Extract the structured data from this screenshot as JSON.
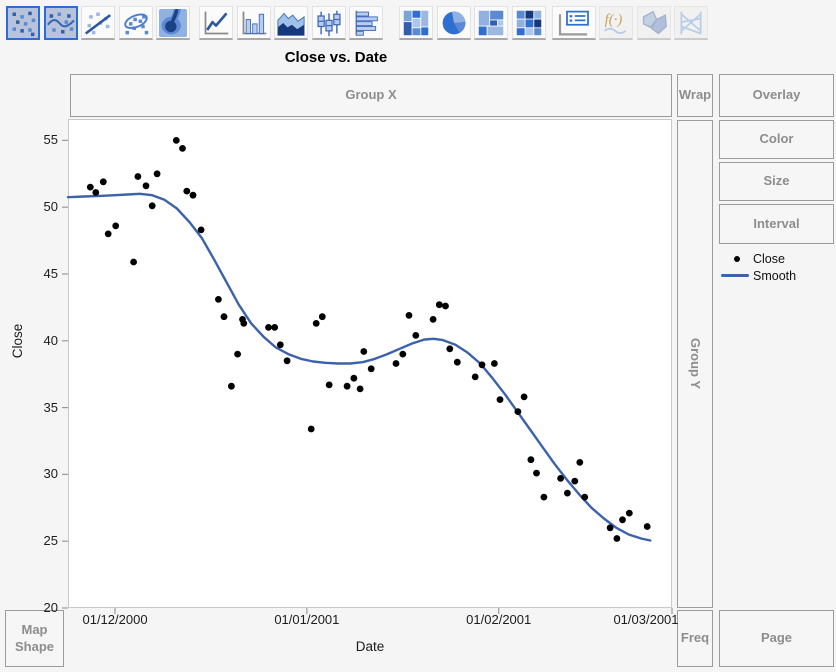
{
  "title": "Close vs. Date",
  "toolbar": {
    "items": [
      {
        "name": "points",
        "state": "selected"
      },
      {
        "name": "smoother",
        "state": "selected"
      },
      {
        "name": "line-of-fit",
        "state": "normal"
      },
      {
        "name": "ellipse",
        "state": "normal"
      },
      {
        "name": "contour",
        "state": "normal"
      },
      {
        "name": "line",
        "state": "normal"
      },
      {
        "name": "bar",
        "state": "normal"
      },
      {
        "name": "area",
        "state": "normal"
      },
      {
        "name": "box-plot",
        "state": "normal"
      },
      {
        "name": "histogram",
        "state": "normal"
      },
      {
        "name": "mosaic",
        "state": "normal"
      },
      {
        "name": "pie",
        "state": "normal"
      },
      {
        "name": "treemap",
        "state": "normal"
      },
      {
        "name": "heatmap",
        "state": "normal"
      },
      {
        "name": "caption-box",
        "state": "normal"
      },
      {
        "name": "formula",
        "state": "disabled"
      },
      {
        "name": "map-shapes",
        "state": "disabled"
      },
      {
        "name": "parallel",
        "state": "disabled"
      }
    ]
  },
  "drop_zones": {
    "group_x": "Group X",
    "wrap": "Wrap",
    "overlay": "Overlay",
    "color": "Color",
    "size": "Size",
    "interval": "Interval",
    "group_y": "Group Y",
    "map_shape": "Map Shape",
    "freq": "Freq",
    "page": "Page"
  },
  "legend": {
    "items": [
      {
        "label": "Close",
        "marker": "dot",
        "color": "#000000"
      },
      {
        "label": "Smooth",
        "marker": "line",
        "color": "#3b62ab"
      }
    ]
  },
  "colors": {
    "accent_blue": "#2e6bd6",
    "smooth_line": "#3b62ab",
    "point": "#000000",
    "zone_text": "#8d8d8d",
    "plot_border": "#c9c9c9",
    "background": "#f5f5f6"
  },
  "chart_data": {
    "type": "scatter",
    "title": "Close vs. Date",
    "xlabel": "Date",
    "ylabel": "Close",
    "grid": false,
    "legend_position": "right",
    "x_unit": "days since 01/12/2000 (axis shows dd/mm/yyyy)",
    "x_domain_days": [
      -7.6,
      90
    ],
    "y_domain": [
      20,
      56.6
    ],
    "x_ticks": [
      {
        "day": 0,
        "label": "01/12/2000"
      },
      {
        "day": 31,
        "label": "01/01/2001"
      },
      {
        "day": 62,
        "label": "01/02/2001"
      },
      {
        "day": 90,
        "label": "01/03/2001"
      }
    ],
    "y_ticks": [
      20,
      25,
      30,
      35,
      40,
      45,
      50,
      55
    ],
    "series": [
      {
        "name": "Close",
        "type": "scatter",
        "color": "#000000",
        "points": [
          [
            -4.0,
            51.5
          ],
          [
            -3.1,
            51.1
          ],
          [
            -1.9,
            51.9
          ],
          [
            -1.1,
            48.0
          ],
          [
            0.1,
            48.6
          ],
          [
            3.0,
            45.9
          ],
          [
            3.7,
            52.3
          ],
          [
            5.0,
            51.6
          ],
          [
            6.0,
            50.1
          ],
          [
            6.8,
            52.5
          ],
          [
            9.9,
            55.0
          ],
          [
            10.9,
            54.4
          ],
          [
            11.6,
            51.2
          ],
          [
            12.6,
            50.9
          ],
          [
            13.9,
            48.3
          ],
          [
            16.7,
            43.1
          ],
          [
            17.6,
            41.8
          ],
          [
            18.8,
            36.6
          ],
          [
            19.8,
            39.0
          ],
          [
            20.6,
            41.6
          ],
          [
            20.8,
            41.3
          ],
          [
            24.8,
            41.0
          ],
          [
            25.8,
            41.0
          ],
          [
            26.7,
            39.7
          ],
          [
            27.8,
            38.5
          ],
          [
            31.7,
            33.4
          ],
          [
            32.5,
            41.3
          ],
          [
            33.5,
            41.8
          ],
          [
            34.6,
            36.7
          ],
          [
            37.5,
            36.6
          ],
          [
            38.6,
            37.2
          ],
          [
            39.6,
            36.4
          ],
          [
            40.2,
            39.2
          ],
          [
            41.4,
            37.9
          ],
          [
            45.4,
            38.3
          ],
          [
            46.5,
            39.0
          ],
          [
            47.5,
            41.9
          ],
          [
            48.6,
            40.4
          ],
          [
            51.4,
            41.6
          ],
          [
            52.4,
            42.7
          ],
          [
            53.4,
            42.6
          ],
          [
            54.1,
            39.4
          ],
          [
            55.3,
            38.4
          ],
          [
            58.2,
            37.3
          ],
          [
            59.3,
            38.2
          ],
          [
            61.3,
            38.3
          ],
          [
            62.2,
            35.6
          ],
          [
            65.1,
            34.7
          ],
          [
            66.1,
            35.8
          ],
          [
            67.2,
            31.1
          ],
          [
            68.1,
            30.1
          ],
          [
            69.3,
            28.3
          ],
          [
            72.0,
            29.7
          ],
          [
            73.1,
            28.6
          ],
          [
            74.3,
            29.5
          ],
          [
            75.1,
            30.9
          ],
          [
            75.9,
            28.3
          ],
          [
            80.0,
            26.0
          ],
          [
            81.1,
            25.2
          ],
          [
            82.0,
            26.6
          ],
          [
            83.1,
            27.1
          ],
          [
            86.0,
            26.1
          ]
        ]
      },
      {
        "name": "Smooth",
        "type": "line",
        "color": "#3b62ab",
        "points": [
          [
            -7.6,
            50.75
          ],
          [
            -5,
            50.8
          ],
          [
            -2,
            50.85
          ],
          [
            0,
            50.9
          ],
          [
            2,
            50.95
          ],
          [
            4,
            51.0
          ],
          [
            6,
            50.9
          ],
          [
            8,
            50.55
          ],
          [
            10,
            49.9
          ],
          [
            12,
            48.9
          ],
          [
            14,
            47.7
          ],
          [
            16,
            46.1
          ],
          [
            18,
            44.4
          ],
          [
            20,
            42.7
          ],
          [
            22,
            41.3
          ],
          [
            24,
            40.3
          ],
          [
            26,
            39.5
          ],
          [
            28,
            39.0
          ],
          [
            30,
            38.65
          ],
          [
            32,
            38.45
          ],
          [
            34,
            38.35
          ],
          [
            36,
            38.3
          ],
          [
            38,
            38.3
          ],
          [
            40,
            38.4
          ],
          [
            42,
            38.65
          ],
          [
            44,
            39.0
          ],
          [
            46,
            39.4
          ],
          [
            48,
            39.8
          ],
          [
            50,
            40.1
          ],
          [
            51.5,
            40.15
          ],
          [
            53,
            40.05
          ],
          [
            55,
            39.7
          ],
          [
            57,
            39.1
          ],
          [
            59,
            38.3
          ],
          [
            61,
            37.2
          ],
          [
            63,
            36.0
          ],
          [
            65,
            34.7
          ],
          [
            67,
            33.4
          ],
          [
            69,
            32.1
          ],
          [
            71,
            30.8
          ],
          [
            73,
            29.6
          ],
          [
            75,
            28.5
          ],
          [
            77,
            27.5
          ],
          [
            79,
            26.7
          ],
          [
            81,
            26.0
          ],
          [
            83,
            25.5
          ],
          [
            85,
            25.2
          ],
          [
            86.5,
            25.05
          ]
        ]
      }
    ]
  }
}
